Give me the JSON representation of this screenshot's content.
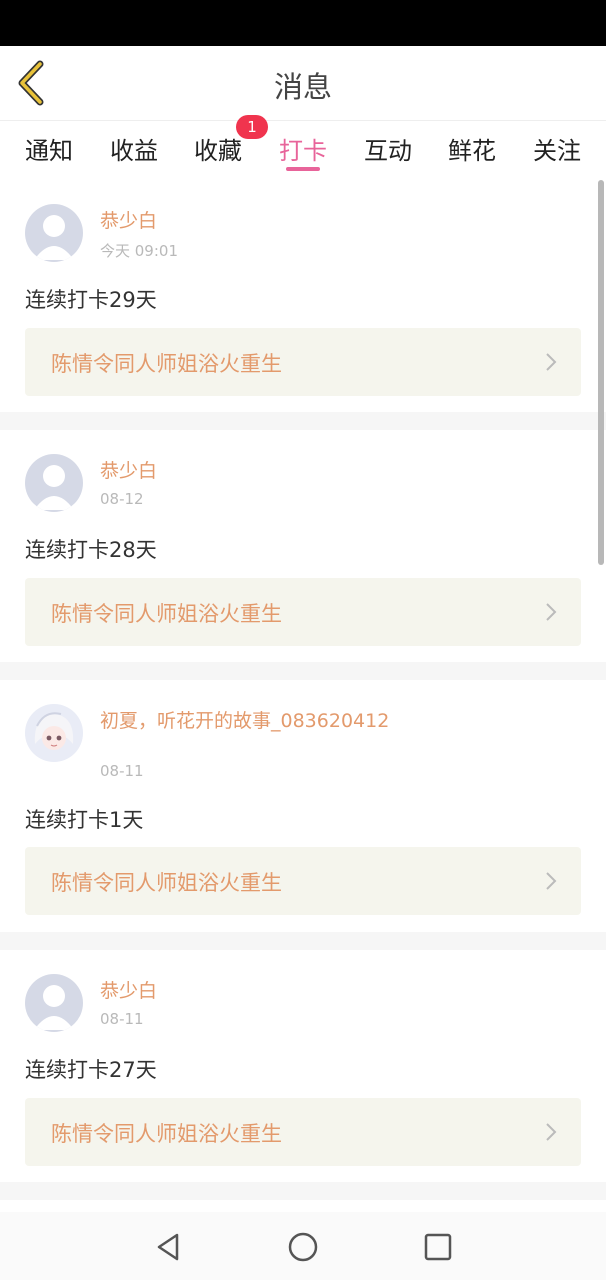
{
  "header": {
    "title": "消息"
  },
  "tabs": [
    {
      "label": "通知"
    },
    {
      "label": "收益"
    },
    {
      "label": "收藏",
      "badge": "1"
    },
    {
      "label": "打卡",
      "active": true
    },
    {
      "label": "互动"
    },
    {
      "label": "鲜花"
    },
    {
      "label": "关注"
    }
  ],
  "feed": [
    {
      "name": "恭少白",
      "time": "今天 09:01",
      "message": "连续打卡29天",
      "book": "陈情令同人师姐浴火重生",
      "avatar": "default-avatar-icon"
    },
    {
      "name": "恭少白",
      "time": "08-12",
      "message": "连续打卡28天",
      "book": "陈情令同人师姐浴火重生",
      "avatar": "default-avatar-icon"
    },
    {
      "name": "初夏，听花开的故事_083620412",
      "time": "08-11",
      "message": "连续打卡1天",
      "book": "陈情令同人师姐浴火重生",
      "avatar": "anime-girl-avatar"
    },
    {
      "name": "恭少白",
      "time": "08-11",
      "message": "连续打卡27天",
      "book": "陈情令同人师姐浴火重生",
      "avatar": "default-avatar-icon"
    }
  ],
  "colors": {
    "accent": "#e8649a",
    "name": "#e39a6c",
    "badge": "#f0344e",
    "back_arrow": "#e8c23a"
  }
}
